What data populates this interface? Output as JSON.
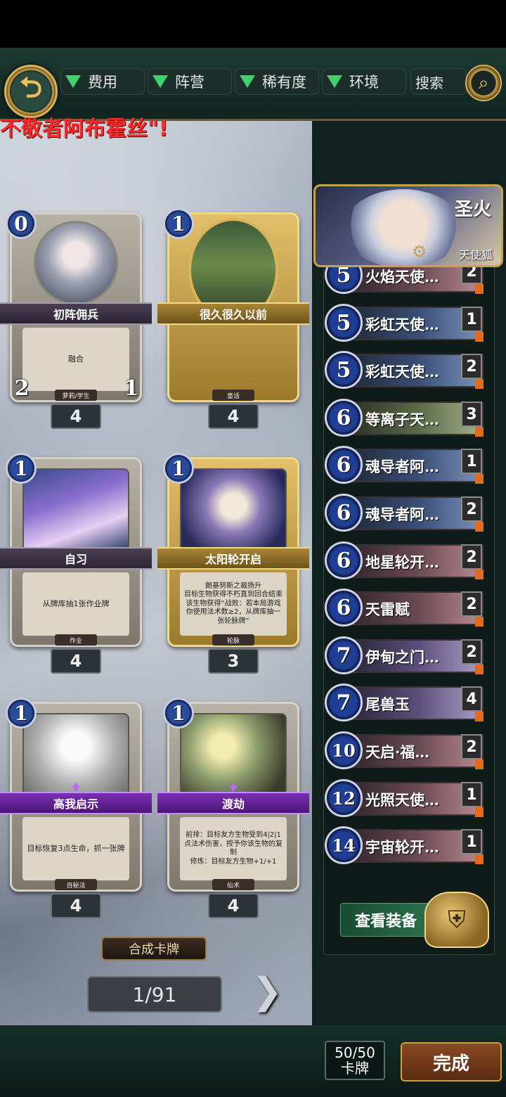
{
  "topbar": {
    "back_icon": "back-arrow-icon",
    "filters": [
      "费用",
      "阵营",
      "稀有度",
      "环境"
    ],
    "search_label": "搜索",
    "search_icon": "magnifier-icon"
  },
  "banner_text": "不敬者阿布霍丝\"!",
  "cards": [
    {
      "cost": "0",
      "name": "初阵佣兵",
      "text": "融合",
      "tag": "萝莉/学生",
      "attack": "2",
      "health": "1",
      "count": "4",
      "frame": "silver"
    },
    {
      "cost": "1",
      "name": "很久很久以前",
      "text": "",
      "tag": "童话",
      "count": "4",
      "frame": "gold"
    },
    {
      "cost": "1",
      "name": "自习",
      "text": "从牌库抽1张作业牌",
      "tag": "作业",
      "count": "4",
      "frame": "silver"
    },
    {
      "cost": "1",
      "name": "太阳轮开启",
      "text": "朗基努斯之裁扬升\n目标生物获得不朽直到回合结束\n该生物获得“战败：若本局游戏你使用法术数≥2，从牌库抽一张轮脉牌”",
      "tag": "轮脉",
      "count": "3",
      "frame": "gold"
    },
    {
      "cost": "1",
      "name": "高我启示",
      "text": "目标恢复3点生命，抓一张牌",
      "tag": "自秘法",
      "count": "4",
      "frame": "silver"
    },
    {
      "cost": "1",
      "name": "渡劫",
      "text": "前排：目标友方生物受到4|2|1点法术伤害，授予你该生物的复制\n修炼：目标友方生物+1/+1",
      "tag": "仙术",
      "count": "4",
      "frame": "silver"
    }
  ],
  "craft_label": "合成卡牌",
  "pager": "1/91",
  "leader": {
    "title": "圣火",
    "subtitle": "天使狐"
  },
  "decklist": [
    {
      "cost": "5",
      "name": "火焰天使…",
      "count": "2",
      "style": "red"
    },
    {
      "cost": "5",
      "name": "彩虹天使…",
      "count": "1",
      "style": "blue"
    },
    {
      "cost": "5",
      "name": "彩虹天使…",
      "count": "2",
      "style": "blue"
    },
    {
      "cost": "6",
      "name": "等离子天…",
      "count": "3",
      "style": "green"
    },
    {
      "cost": "6",
      "name": "魂导者阿…",
      "count": "1",
      "style": "blue"
    },
    {
      "cost": "6",
      "name": "魂导者阿…",
      "count": "2",
      "style": "blue"
    },
    {
      "cost": "6",
      "name": "地星轮开…",
      "count": "2",
      "style": "red"
    },
    {
      "cost": "6",
      "name": "天雷赋",
      "count": "2",
      "style": "red"
    },
    {
      "cost": "7",
      "name": "伊甸之门…",
      "count": "2",
      "style": "violet"
    },
    {
      "cost": "7",
      "name": "尾兽玉",
      "count": "4",
      "style": "violet"
    },
    {
      "cost": "10",
      "name": "天启·福…",
      "count": "2",
      "style": "red"
    },
    {
      "cost": "12",
      "name": "光照天使…",
      "count": "1",
      "style": "red"
    },
    {
      "cost": "14",
      "name": "宇宙轮开…",
      "count": "1",
      "style": "red"
    }
  ],
  "equip_label": "查看装备",
  "deck_count": {
    "value": "50/50",
    "label": "卡牌"
  },
  "done_label": "完成"
}
